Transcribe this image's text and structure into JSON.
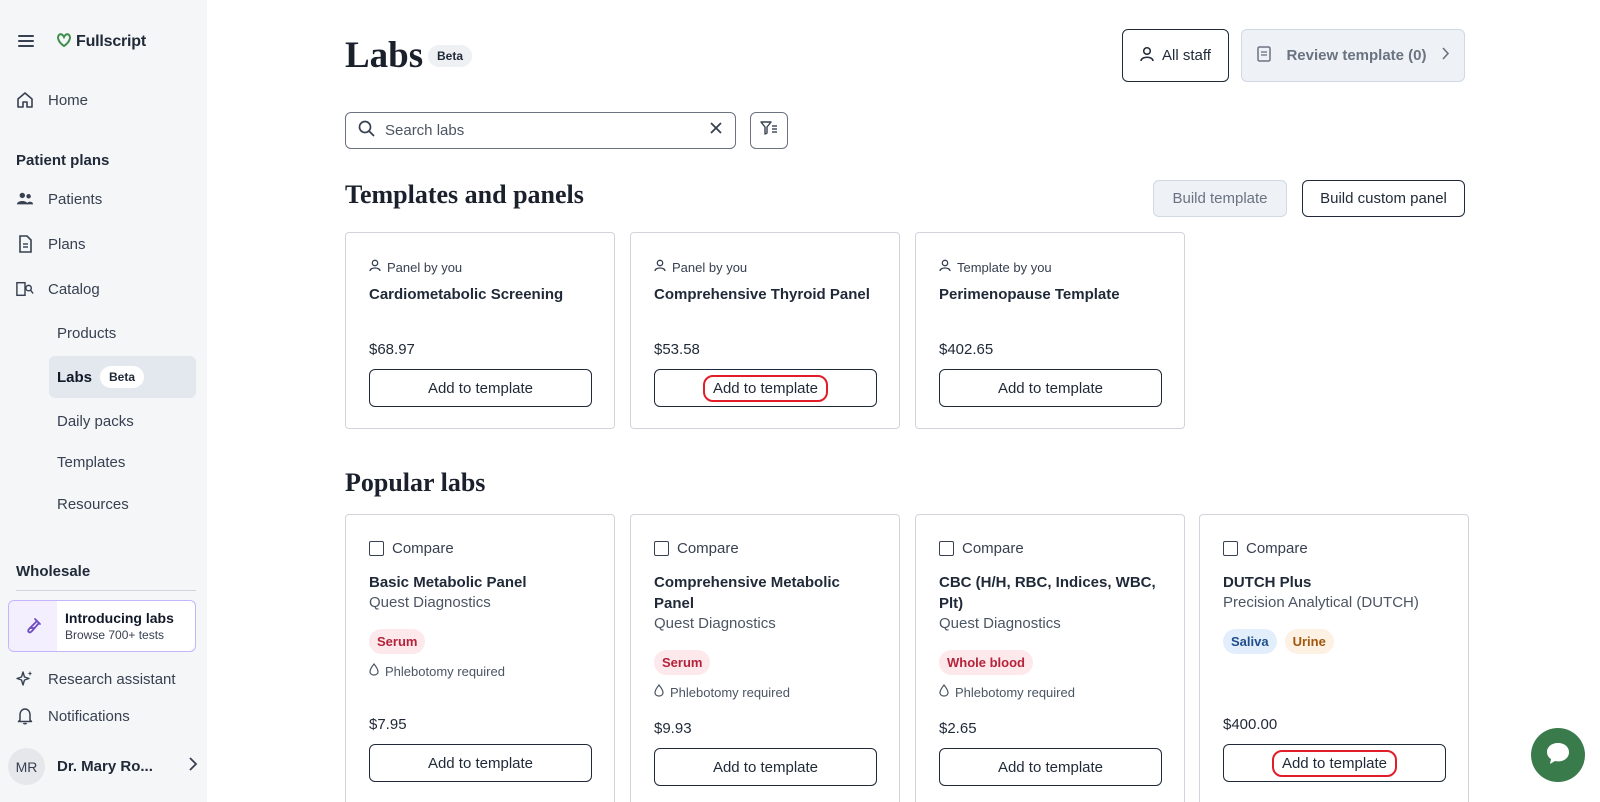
{
  "brand": {
    "name": "Fullscript"
  },
  "sidebar": {
    "home": "Home",
    "patient_plans_heading": "Patient plans",
    "patients": "Patients",
    "plans": "Plans",
    "catalog": "Catalog",
    "catalog_items": {
      "products": "Products",
      "labs": "Labs",
      "labs_badge": "Beta",
      "daily_packs": "Daily packs",
      "templates": "Templates",
      "resources": "Resources"
    },
    "wholesale_heading": "Wholesale",
    "promo": {
      "title": "Introducing labs",
      "subtitle": "Browse 700+ tests"
    },
    "research_assistant": "Research assistant",
    "notifications": "Notifications",
    "user": {
      "initials": "MR",
      "name": "Dr. Mary Ro..."
    }
  },
  "header": {
    "title": "Labs",
    "badge": "Beta",
    "all_staff": "All staff",
    "review_template": "Review template (0)"
  },
  "search": {
    "placeholder": "Search labs"
  },
  "templates_section": {
    "heading": "Templates and panels",
    "build_template": "Build template",
    "build_custom_panel": "Build custom panel",
    "cards": [
      {
        "meta": "Panel by you",
        "title": "Cardiometabolic Screening",
        "price": "$68.97",
        "action": "Add to template"
      },
      {
        "meta": "Panel by you",
        "title": "Comprehensive Thyroid Panel",
        "price": "$53.58",
        "action": "Add to template"
      },
      {
        "meta": "Template by you",
        "title": "Perimenopause Template",
        "price": "$402.65",
        "action": "Add to template"
      }
    ]
  },
  "popular_section": {
    "heading": "Popular labs",
    "compare_label": "Compare",
    "phlebotomy_label": "Phlebotomy required",
    "cards": [
      {
        "title": "Basic Metabolic Panel",
        "vendor": "Quest Diagnostics",
        "tags": [
          "Serum"
        ],
        "price": "$7.95",
        "action": "Add to template"
      },
      {
        "title": "Comprehensive Metabolic Panel",
        "vendor": "Quest Diagnostics",
        "tags": [
          "Serum"
        ],
        "price": "$9.93",
        "action": "Add to template"
      },
      {
        "title": "CBC (H/H, RBC, Indices, WBC, Plt)",
        "vendor": "Quest Diagnostics",
        "tags": [
          "Whole blood"
        ],
        "price": "$2.65",
        "action": "Add to template"
      },
      {
        "title": "DUTCH Plus",
        "vendor": "Precision Analytical (DUTCH)",
        "tags": [
          "Saliva",
          "Urine"
        ],
        "price": "$400.00",
        "action": "Add to template"
      }
    ]
  },
  "colors": {
    "accent_green": "#3a7b4c",
    "highlight_red": "#e11d2a",
    "sidebar_bg": "#f5f6f8"
  }
}
